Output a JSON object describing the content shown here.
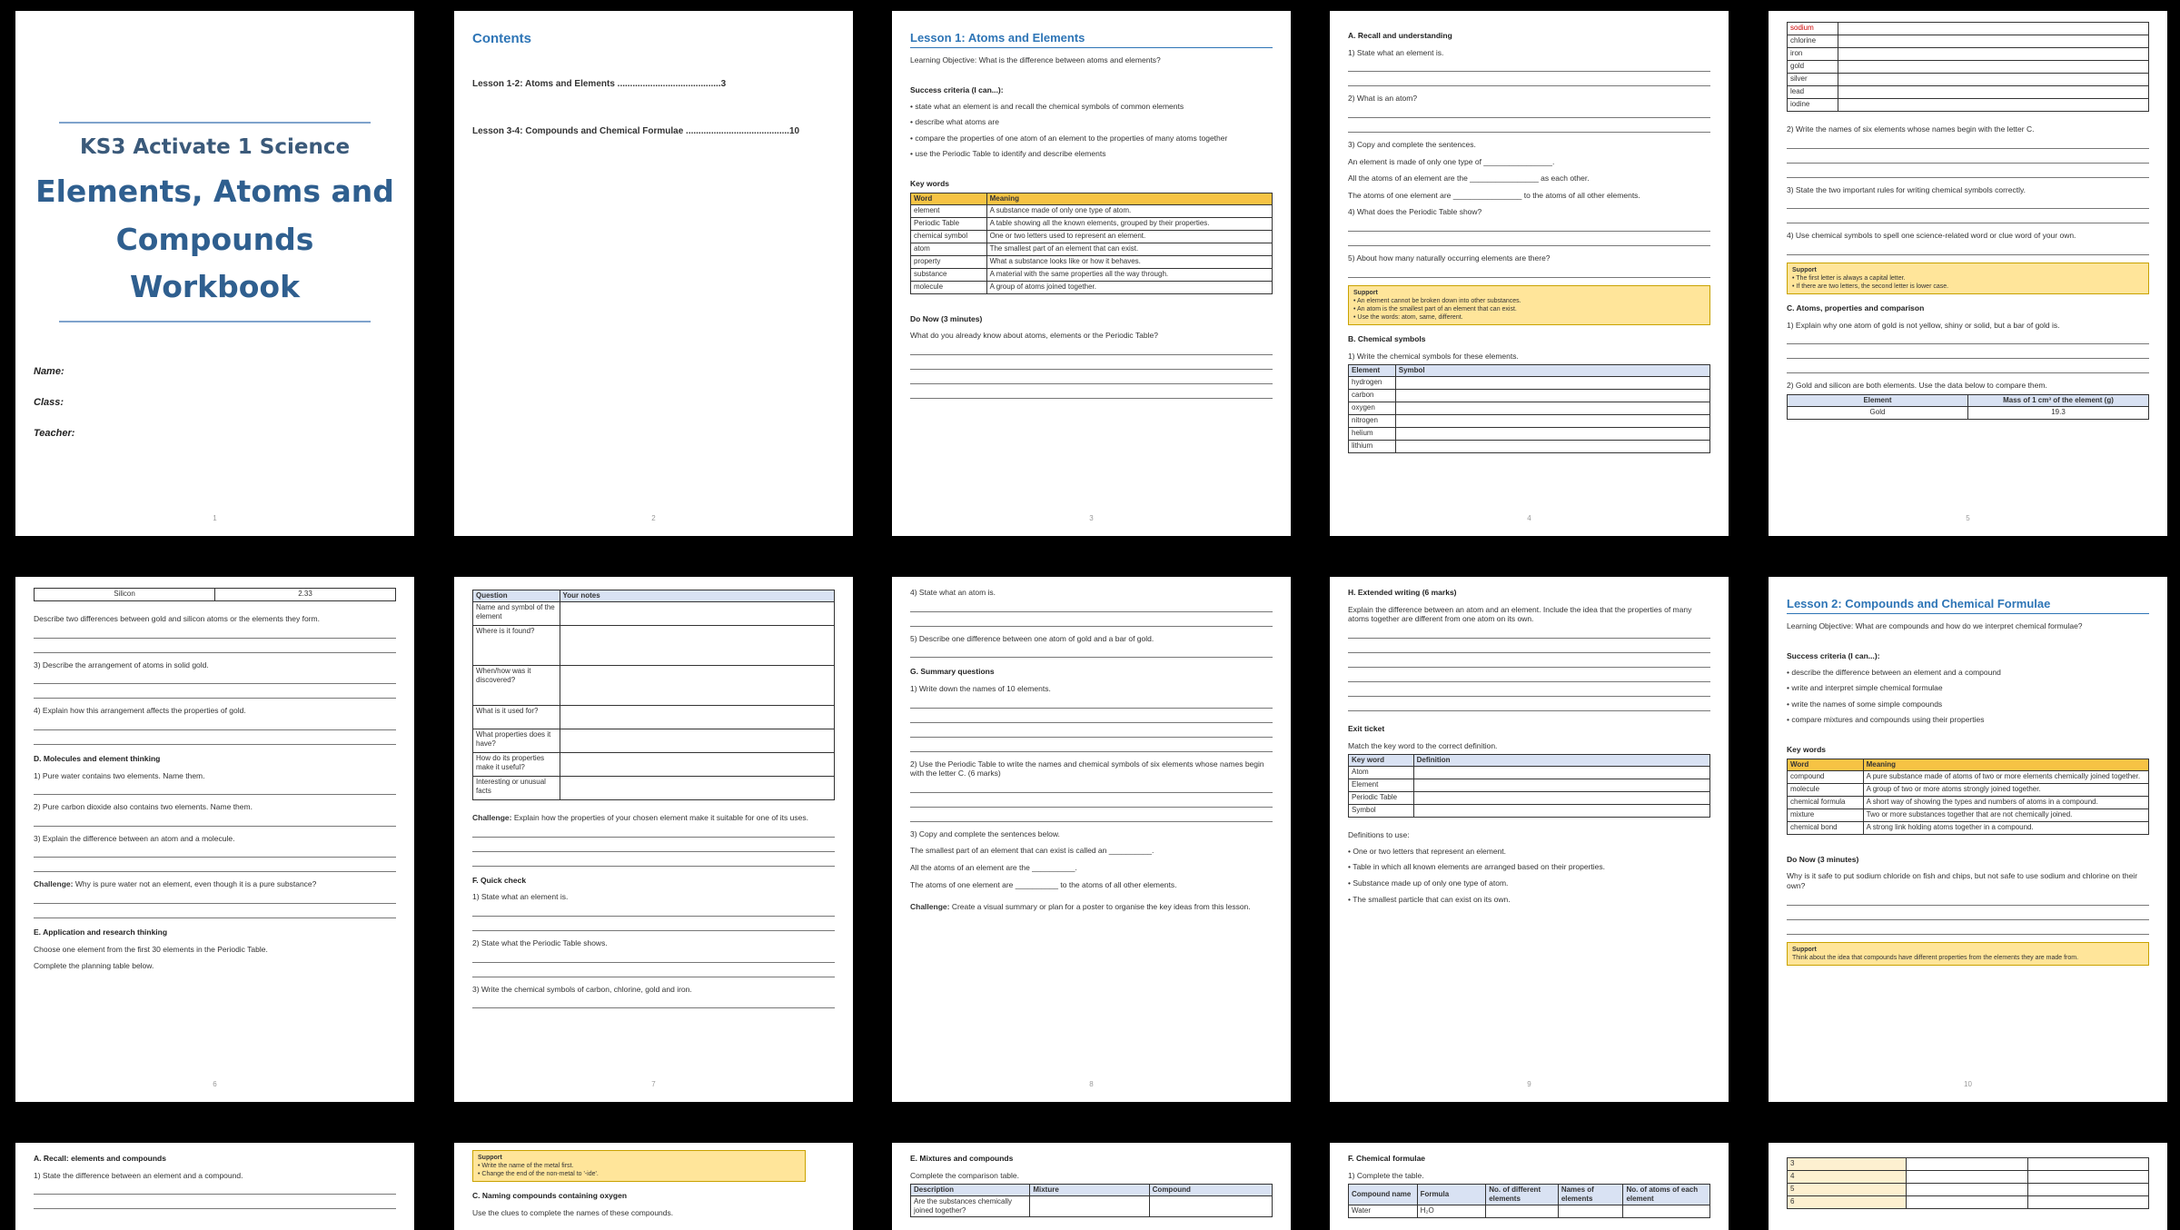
{
  "p1": {
    "subtitle": "KS3 Activate 1 Science",
    "title_line1": "Elements, Atoms and",
    "title_line2": "Compounds Workbook",
    "fields": [
      "Name:",
      "Class:",
      "Teacher:"
    ],
    "num": "1"
  },
  "p2": {
    "heading": "Contents",
    "toc": [
      "Lesson 1-2: Atoms and Elements .........................................3",
      "Lesson 3-4: Compounds and Chemical Formulae .........................................10"
    ],
    "num": "2"
  },
  "p3": {
    "heading": "Lesson 1: Atoms and Elements",
    "objective": "Learning Objective: What is the difference between atoms and elements?",
    "criteria_h": "Success criteria (I can...):",
    "criteria": [
      "state what an element is and recall the chemical symbols of common elements",
      "describe what atoms are",
      "compare the properties of one atom of an element to the properties of many atoms together",
      "use the Periodic Table to identify and describe elements"
    ],
    "kw_h": "Key words",
    "kw_head": [
      "Word",
      "Meaning"
    ],
    "kw": [
      [
        "element",
        "A substance made of only one type of atom."
      ],
      [
        "Periodic Table",
        "A table showing all the known elements, grouped by their properties."
      ],
      [
        "chemical symbol",
        "One or two letters used to represent an element."
      ],
      [
        "atom",
        "The smallest part of an element that can exist."
      ],
      [
        "property",
        "What a substance looks like or how it behaves."
      ],
      [
        "substance",
        "A material with the same properties all the way through."
      ],
      [
        "molecule",
        "A group of atoms joined together."
      ]
    ],
    "donow_h": "Do Now (3 minutes)",
    "donow": "What do you already know about atoms, elements or the Periodic Table?",
    "num": "3"
  },
  "p4": {
    "secA": "A. Recall and understanding",
    "q1": "1) State what an element is.",
    "q2": "2) What is an atom?",
    "q3": "3) Copy and complete the sentences.",
    "s1": "An element is made of only one type of ________________.",
    "s2": "All the atoms of an element are the ________________ as each other.",
    "s3": "The atoms of one element are ________________ to the atoms of all other elements.",
    "q4": "4) What does the Periodic Table show?",
    "q5": "5) About how many naturally occurring elements are there?",
    "support_h": "Support",
    "support": [
      "• An element cannot be broken down into other substances.",
      "• An atom is the smallest part of an element that can exist.",
      "• Use the words: atom, same, different."
    ],
    "secB": "B. Chemical symbols",
    "qb1": "1) Write the chemical symbols for these elements.",
    "tbl_head": [
      "Element",
      "Symbol"
    ],
    "tbl": [
      "hydrogen",
      "carbon",
      "oxygen",
      "nitrogen",
      "helium",
      "lithium"
    ],
    "num": "4"
  },
  "p5": {
    "tbl_top": [
      "sodium",
      "chlorine",
      "iron",
      "gold",
      "silver",
      "lead",
      "iodine"
    ],
    "q2": "2) Write the names of six elements whose names begin with the letter C.",
    "q3": "3) State the two important rules for writing chemical symbols correctly.",
    "q4": "4) Use chemical symbols to spell one science-related word or clue word of your own.",
    "support_h": "Support",
    "support": [
      "• The first letter is always a capital letter.",
      "• If there are two letters, the second letter is lower case."
    ],
    "secC": "C. Atoms, properties and comparison",
    "qc1": "1) Explain why one atom of gold is not yellow, shiny or solid, but a bar of gold is.",
    "qc2": "2) Gold and silicon are both elements. Use the data below to compare them.",
    "tbl_head": [
      "Element",
      "Mass of 1 cm³ of the element (g)"
    ],
    "tbl": [
      [
        "Gold",
        "19.3"
      ]
    ],
    "num": "5"
  },
  "p6": {
    "row": [
      "Silicon",
      "2.33"
    ],
    "q1": "Describe two differences between gold and silicon atoms or the elements they form.",
    "q3": "3) Describe the arrangement of atoms in solid gold.",
    "q4": "4) Explain how this arrangement affects the properties of gold.",
    "secD": "D. Molecules and element thinking",
    "d1": "1) Pure water contains two elements. Name them.",
    "d2": "2) Pure carbon dioxide also contains two elements. Name them.",
    "d3": "3) Explain the difference between an atom and a molecule.",
    "challenge_label": "Challenge:",
    "challenge": "Why is pure water not an element, even though it is a pure substance?",
    "secE": "E. Application and research thinking",
    "e1": "Choose one element from the first 30 elements in the Periodic Table.",
    "e2": "Complete the planning table below.",
    "num": "6"
  },
  "p7": {
    "tbl_head": [
      "Question",
      "Your notes"
    ],
    "tbl": [
      "Name and symbol of the element",
      "Where is it found?",
      "When/how was it discovered?",
      "What is it used for?",
      "What properties does it have?",
      "How do its properties make it useful?",
      "Interesting or unusual facts"
    ],
    "challenge_label": "Challenge:",
    "challenge": "Explain how the properties of your chosen element make it suitable for one of its uses.",
    "secF": "F. Quick check",
    "f1": "1) State what an element is.",
    "f2": "2) State what the Periodic Table shows.",
    "f3": "3) Write the chemical symbols of carbon, chlorine, gold and iron.",
    "num": "7"
  },
  "p8": {
    "q4": "4) State what an atom is.",
    "q5": "5) Describe one difference between one atom of gold and a bar of gold.",
    "secG": "G. Summary questions",
    "g1": "1) Write down the names of 10 elements.",
    "g2": "2) Use the Periodic Table to write the names and chemical symbols of six elements whose names begin with the letter C. (6 marks)",
    "g3": "3) Copy and complete the sentences below.",
    "s1": "The smallest part of an element that can exist is called an __________.",
    "s2": "All the atoms of an element are the __________.",
    "s3": "The atoms of one element are __________ to the atoms of all other elements.",
    "challenge_label": "Challenge:",
    "challenge": "Create a visual summary or plan for a poster to organise the key ideas from this lesson.",
    "num": "8"
  },
  "p9": {
    "secH": "H. Extended writing (6 marks)",
    "h1": "Explain the difference between an atom and an element. Include the idea that the properties of many atoms together are different from one atom on its own.",
    "exit_h": "Exit ticket",
    "exit": "Match the key word to the correct definition.",
    "tbl_head": [
      "Key word",
      "Definition"
    ],
    "tbl": [
      "Atom",
      "Element",
      "Periodic Table",
      "Symbol"
    ],
    "defs_h": "Definitions to use:",
    "defs": [
      "One or two letters that represent an element.",
      "Table in which all known elements are arranged based on their properties.",
      "Substance made up of only one type of atom.",
      "The smallest particle that can exist on its own."
    ],
    "num": "9"
  },
  "p10": {
    "heading": "Lesson 2: Compounds and Chemical Formulae",
    "objective": "Learning Objective: What are compounds and how do we interpret chemical formulae?",
    "criteria_h": "Success criteria (I can...):",
    "criteria": [
      "describe the difference between an element and a compound",
      "write and interpret simple chemical formulae",
      "write the names of some simple compounds",
      "compare mixtures and compounds using their properties"
    ],
    "kw_h": "Key words",
    "kw_head": [
      "Word",
      "Meaning"
    ],
    "kw": [
      [
        "compound",
        "A pure substance made of atoms of two or more elements chemically joined together."
      ],
      [
        "molecule",
        "A group of two or more atoms strongly joined together."
      ],
      [
        "chemical formula",
        "A short way of showing the types and numbers of atoms in a compound."
      ],
      [
        "mixture",
        "Two or more substances together that are not chemically joined."
      ],
      [
        "chemical bond",
        "A strong link holding atoms together in a compound."
      ]
    ],
    "donow_h": "Do Now (3 minutes)",
    "donow": "Why is it safe to put sodium chloride on fish and chips, but not safe to use sodium and chlorine on their own?",
    "support_h": "Support",
    "support": "Think about the idea that compounds have different properties from the elements they are made from.",
    "num": "10"
  },
  "p11": {
    "secA": "A. Recall: elements and compounds",
    "q1": "1) State the difference between an element and a compound."
  },
  "p12": {
    "support_h": "Support",
    "support": [
      "• Write the name of the metal first.",
      "• Change the end of the non-metal to '-ide'."
    ],
    "secC": "C. Naming compounds containing oxygen",
    "c1": "Use the clues to complete the names of these compounds."
  },
  "p13": {
    "secE": "E. Mixtures and compounds",
    "e1": "Complete the comparison table.",
    "tbl_head": [
      "Description",
      "Mixture",
      "Compound"
    ],
    "row1": "Are the substances chemically joined together?"
  },
  "p14": {
    "secF": "F. Chemical formulae",
    "f1": "1) Complete the table.",
    "tbl_head": [
      "Compound name",
      "Formula",
      "No. of different elements",
      "Names of elements",
      "No. of atoms of each element"
    ],
    "row1": [
      "Water",
      "H₂O"
    ]
  },
  "p15": {
    "rows": [
      "3",
      "4",
      "5",
      "6"
    ]
  }
}
